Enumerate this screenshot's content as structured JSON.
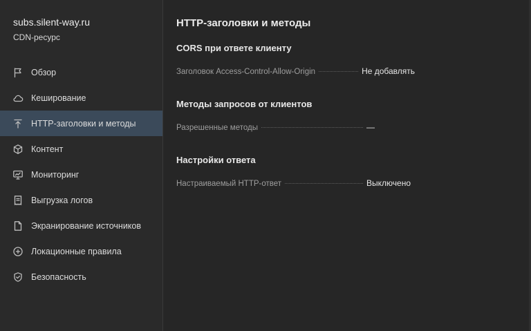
{
  "resource": {
    "name": "subs.silent-way.ru",
    "type": "CDN-ресурс"
  },
  "sidebar": {
    "items": [
      {
        "label": "Обзор",
        "icon": "flag-icon",
        "active": false
      },
      {
        "label": "Кеширование",
        "icon": "cloud-icon",
        "active": false
      },
      {
        "label": "HTTP-заголовки и методы",
        "icon": "upload-arrow-icon",
        "active": true
      },
      {
        "label": "Контент",
        "icon": "cube-icon",
        "active": false
      },
      {
        "label": "Мониторинг",
        "icon": "monitor-chart-icon",
        "active": false
      },
      {
        "label": "Выгрузка логов",
        "icon": "receipt-icon",
        "active": false
      },
      {
        "label": "Экранирование источников",
        "icon": "document-icon",
        "active": false
      },
      {
        "label": "Локационные правила",
        "icon": "location-plus-icon",
        "active": false
      },
      {
        "label": "Безопасность",
        "icon": "shield-icon",
        "active": false
      }
    ]
  },
  "main": {
    "title": "HTTP-заголовки и методы",
    "sections": [
      {
        "title": "CORS при ответе клиенту",
        "rows": [
          {
            "label": "Заголовок Access-Control-Allow-Origin",
            "value": "Не добавлять"
          }
        ]
      },
      {
        "title": "Методы запросов от клиентов",
        "rows": [
          {
            "label": "Разрешенные методы",
            "value": "—"
          }
        ]
      },
      {
        "title": "Настройки ответа",
        "rows": [
          {
            "label": "Настраиваемый HTTP-ответ",
            "value": "Выключено"
          }
        ]
      }
    ]
  },
  "colors": {
    "background": "#262626",
    "sidebar": "#2a2a2a",
    "active_item": "#3b4a5a",
    "muted_text": "#9e9e9e"
  }
}
